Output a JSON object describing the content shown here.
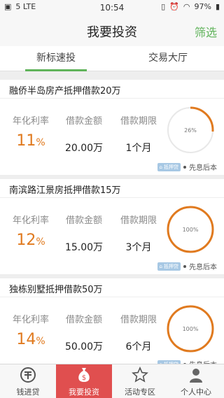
{
  "status_bar": {
    "left_text": "5 LTE",
    "time": "10:54",
    "battery": "97%"
  },
  "header": {
    "title": "我要投资",
    "filter_label": "筛选"
  },
  "tabs": [
    {
      "label": "新标速投"
    },
    {
      "label": "交易大厅"
    }
  ],
  "labels": {
    "rate": "年化利率",
    "amount": "借款金额",
    "term": "借款期限",
    "tag": "抵押贷",
    "repayment": "先息后本"
  },
  "loans": [
    {
      "title": "融侨半岛房产抵押借款20万",
      "rate_num": "11",
      "rate_unit": "%",
      "amount": "20.00万",
      "term": "1个月",
      "progress_text": "26%",
      "progress": 0.26
    },
    {
      "title": "南滨路江景房抵押借款15万",
      "rate_num": "12",
      "rate_unit": "%",
      "amount": "15.00万",
      "term": "3个月",
      "progress_text": "100%",
      "progress": 1.0
    },
    {
      "title": "独栋别墅抵押借款50万",
      "rate_num": "14",
      "rate_unit": "%",
      "amount": "50.00万",
      "term": "6个月",
      "progress_text": "100%",
      "progress": 1.0
    }
  ],
  "bottom_nav": [
    {
      "label": "钱进贷",
      "icon": "coin-icon"
    },
    {
      "label": "我要投资",
      "icon": "money-bag-icon"
    },
    {
      "label": "活动专区",
      "icon": "star-icon"
    },
    {
      "label": "个人中心",
      "icon": "person-icon"
    }
  ],
  "colors": {
    "accent_green": "#5fb35a",
    "accent_orange": "#e07a1f",
    "active_tab_red": "#e04f4f"
  }
}
